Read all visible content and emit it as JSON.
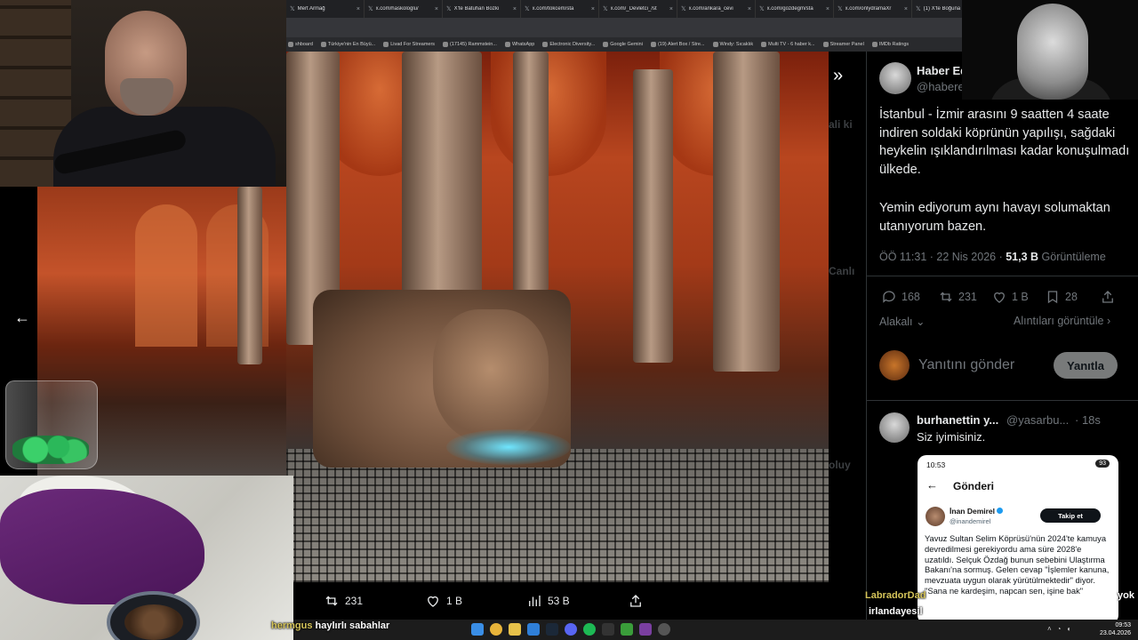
{
  "browser": {
    "tabs": [
      {
        "label": "Mert Armağ"
      },
      {
        "label": "x.com/haskologlu/"
      },
      {
        "label": "X'te Batuhan Bozkı"
      },
      {
        "label": "x.com/tokcem/sta"
      },
      {
        "label": "x.com/_Devletci_/st"
      },
      {
        "label": "x.com/ankara_cevi"
      },
      {
        "label": "x.com/gozdegm/sta"
      },
      {
        "label": "x.com/onlydramaXr"
      },
      {
        "label": "(1) X'te Boğuna Tiki"
      }
    ],
    "bookmarks": [
      {
        "label": "shboard"
      },
      {
        "label": "Türkiye'nin En Büyü..."
      },
      {
        "label": "Livad For Streamers"
      },
      {
        "label": "(17145) Rammstein..."
      },
      {
        "label": "WhatsApp"
      },
      {
        "label": "Electronic Diversity..."
      },
      {
        "label": "Google Gemini"
      },
      {
        "label": "(19) Alert Box / Stre..."
      },
      {
        "label": "Windy: Sıcaklık"
      },
      {
        "label": "Multi TV - 6 haber k..."
      },
      {
        "label": "Streamer Panel"
      },
      {
        "label": "IMDb Ratings"
      }
    ]
  },
  "viewer": {
    "prev_icon": "arrow-left-icon",
    "next_icon": "double-chevron-right-icon",
    "actions": {
      "retweets": "231",
      "likes": "1 B",
      "views": "53 B"
    }
  },
  "tweet": {
    "author_name": "Haber Ed",
    "author_handle": "@habere",
    "body_p1": "İstanbul - İzmir arasını 9 saatten 4 saate indiren soldaki köprünün yapılışı, sağdaki heykelin ışıklandırılması kadar konuşulmadı ülkede.",
    "body_p2": "Yemin ediyorum aynı havayı solumaktan utanıyorum bazen.",
    "time": "ÖÖ 11:31 · 22 Nis 2026 · ",
    "views_count": "51,3 B",
    "views_label": " Görüntüleme",
    "stats": {
      "replies": "168",
      "retweets": "231",
      "likes": "1 B",
      "bookmarks": "28"
    },
    "relevant_label": "Alakalı",
    "quotes_label": "Alıntıları görüntüle",
    "reply_placeholder": "Yanıtını gönder",
    "reply_button": "Yanıtla"
  },
  "reply": {
    "author_name": "burhanettin y...",
    "author_handle": "@yasarbu...",
    "age": "· 18s",
    "text": "Siz iyimisiniz."
  },
  "embedded": {
    "status_time": "10:53",
    "status_badge": "93",
    "title": "Gönderi",
    "name": "İnan Demirel",
    "handle": "@inandemirel",
    "follow": "Takip et",
    "body": "Yavuz Sultan Selim Köprüsü'nün 2024'te kamuya devredilmesi gerekiyordu ama süre 2028'e uzatıldı. Selçuk Özdağ bunun sebebini Ulaştırma Bakanı'na sormuş. Gelen cevap \"İşlemler kanuna, mevzuata uygun olarak yürütülmektedir\" diyor. \"Sana ne kardeşim, napcan sen, işine bak\""
  },
  "chat": [
    {
      "user": "LabradorDad",
      "color": "#d6c55a",
      "message": "",
      "suffix": "yok"
    },
    {
      "user": "irlandayesil",
      "color": "#ffffff",
      "message": ""
    },
    {
      "user": "hermgus",
      "color": "#d6c55a",
      "message": "haylırlı sabahlar"
    }
  ],
  "taskbar": {
    "clock_time": "09:53",
    "clock_date": "23.04.2026"
  },
  "colors": {
    "bg": "#000000",
    "text": "#e7e9ea",
    "muted": "#71767b",
    "divider": "#2f3336"
  }
}
